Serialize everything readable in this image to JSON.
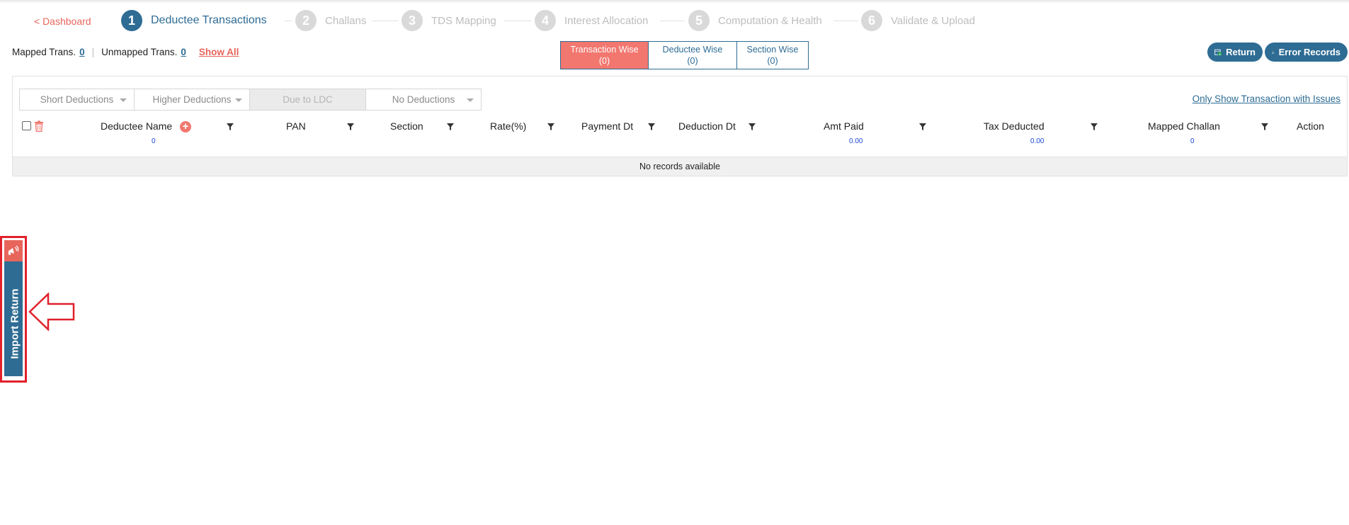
{
  "nav": {
    "back_label": "< Dashboard"
  },
  "steps": [
    {
      "num": "1",
      "label": "Deductee Transactions"
    },
    {
      "num": "2",
      "label": "Challans"
    },
    {
      "num": "3",
      "label": "TDS Mapping"
    },
    {
      "num": "4",
      "label": "Interest Allocation"
    },
    {
      "num": "5",
      "label": "Computation & Health"
    },
    {
      "num": "6",
      "label": "Validate & Upload"
    }
  ],
  "summary": {
    "mapped_label": "Mapped Trans.",
    "mapped_count": "0",
    "separator": "|",
    "unmapped_label": "Unmapped Trans.",
    "unmapped_count": "0",
    "show_all": "Show All"
  },
  "view_tabs": [
    {
      "label": "Transaction Wise",
      "count": "(0)",
      "active": true
    },
    {
      "label": "Deductee Wise",
      "count": "(0)",
      "active": false
    },
    {
      "label": "Section Wise",
      "count": "(0)",
      "active": false
    }
  ],
  "buttons": {
    "return": "Return",
    "error_records": "Error Records"
  },
  "filters": {
    "short": "Short Deductions",
    "higher": "Higher Deductions",
    "ldc": "Due to LDC",
    "none": "No Deductions",
    "issues_link": "Only Show Transaction with Issues"
  },
  "table": {
    "columns": {
      "deductee_name": "Deductee Name",
      "pan": "PAN",
      "section": "Section",
      "rate": "Rate(%)",
      "payment_dt": "Payment Dt",
      "deduction_dt": "Deduction Dt",
      "amt_paid": "Amt Paid",
      "tax_deducted": "Tax Deducted",
      "mapped_challan": "Mapped Challan",
      "action": "Action"
    },
    "totals": {
      "deductee_count": "0",
      "amt_paid": "0.00",
      "tax_deducted": "0.00",
      "mapped_challan": "0"
    },
    "empty_message": "No records available"
  },
  "side_tab": {
    "label": "Import Return"
  },
  "colors": {
    "primary": "#2e6c94",
    "accent": "#f2776f",
    "highlight": "#e0212b"
  }
}
